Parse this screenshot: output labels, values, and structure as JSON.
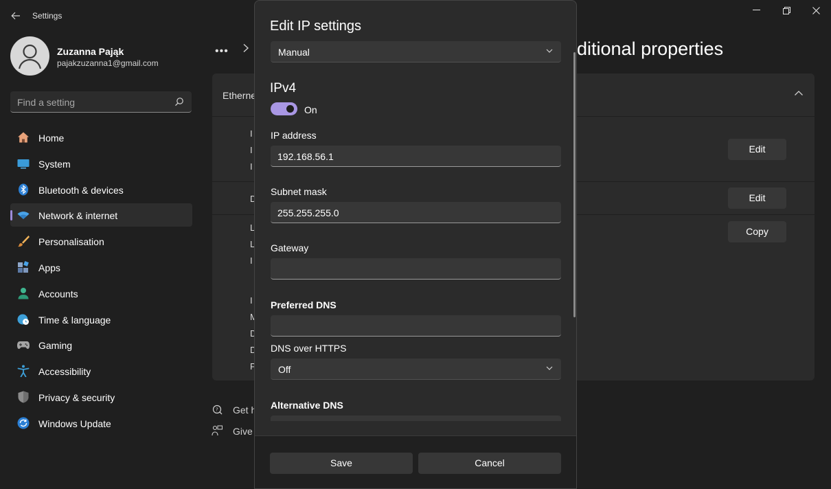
{
  "window": {
    "title": "Settings",
    "back_icon": "back-arrow-icon",
    "controls": [
      "minimize-icon",
      "restore-icon",
      "close-icon"
    ]
  },
  "profile": {
    "name": "Zuzanna Pająk",
    "email": "pajakzuzanna1@gmail.com"
  },
  "search": {
    "placeholder": "Find a setting"
  },
  "sidebar": {
    "items": [
      {
        "label": "Home",
        "icon": "home-icon",
        "active": false
      },
      {
        "label": "System",
        "icon": "system-icon",
        "active": false
      },
      {
        "label": "Bluetooth & devices",
        "icon": "bluetooth-icon",
        "active": false
      },
      {
        "label": "Network & internet",
        "icon": "wifi-icon",
        "active": true
      },
      {
        "label": "Personalisation",
        "icon": "brush-icon",
        "active": false
      },
      {
        "label": "Apps",
        "icon": "apps-icon",
        "active": false
      },
      {
        "label": "Accounts",
        "icon": "person-icon",
        "active": false
      },
      {
        "label": "Time & language",
        "icon": "globe-clock-icon",
        "active": false
      },
      {
        "label": "Gaming",
        "icon": "gamepad-icon",
        "active": false
      },
      {
        "label": "Accessibility",
        "icon": "accessibility-icon",
        "active": false
      },
      {
        "label": "Privacy & security",
        "icon": "shield-icon",
        "active": false
      },
      {
        "label": "Windows Update",
        "icon": "update-icon",
        "active": false
      }
    ]
  },
  "background": {
    "page_title": "ditional properties",
    "panel_heading": "Etherne",
    "edit_label": "Edit",
    "edit_label_2": "Edit",
    "copy_label": "Copy",
    "row_letters": [
      "I",
      "I",
      "I",
      "D",
      "L",
      "L",
      "I",
      "I",
      "M",
      "D",
      "D",
      "P"
    ],
    "help_link_1": "Get h",
    "help_link_2": "Give f"
  },
  "dialog": {
    "title": "Edit IP settings",
    "mode": "Manual",
    "section": "IPv4",
    "toggle_label": "On",
    "ip_label": "IP address",
    "ip_value": "192.168.56.1",
    "subnet_label": "Subnet mask",
    "subnet_value": "255.255.255.0",
    "gateway_label": "Gateway",
    "gateway_value": "",
    "preferred_dns_label": "Preferred DNS",
    "preferred_dns_value": "",
    "dns_https_label": "DNS over HTTPS",
    "dns_https_value": "Off",
    "alt_dns_label": "Alternative DNS",
    "save_label": "Save",
    "cancel_label": "Cancel"
  },
  "colors": {
    "accent": "#a997e4",
    "background": "#1f1f1f",
    "surface": "#2b2b2b"
  }
}
